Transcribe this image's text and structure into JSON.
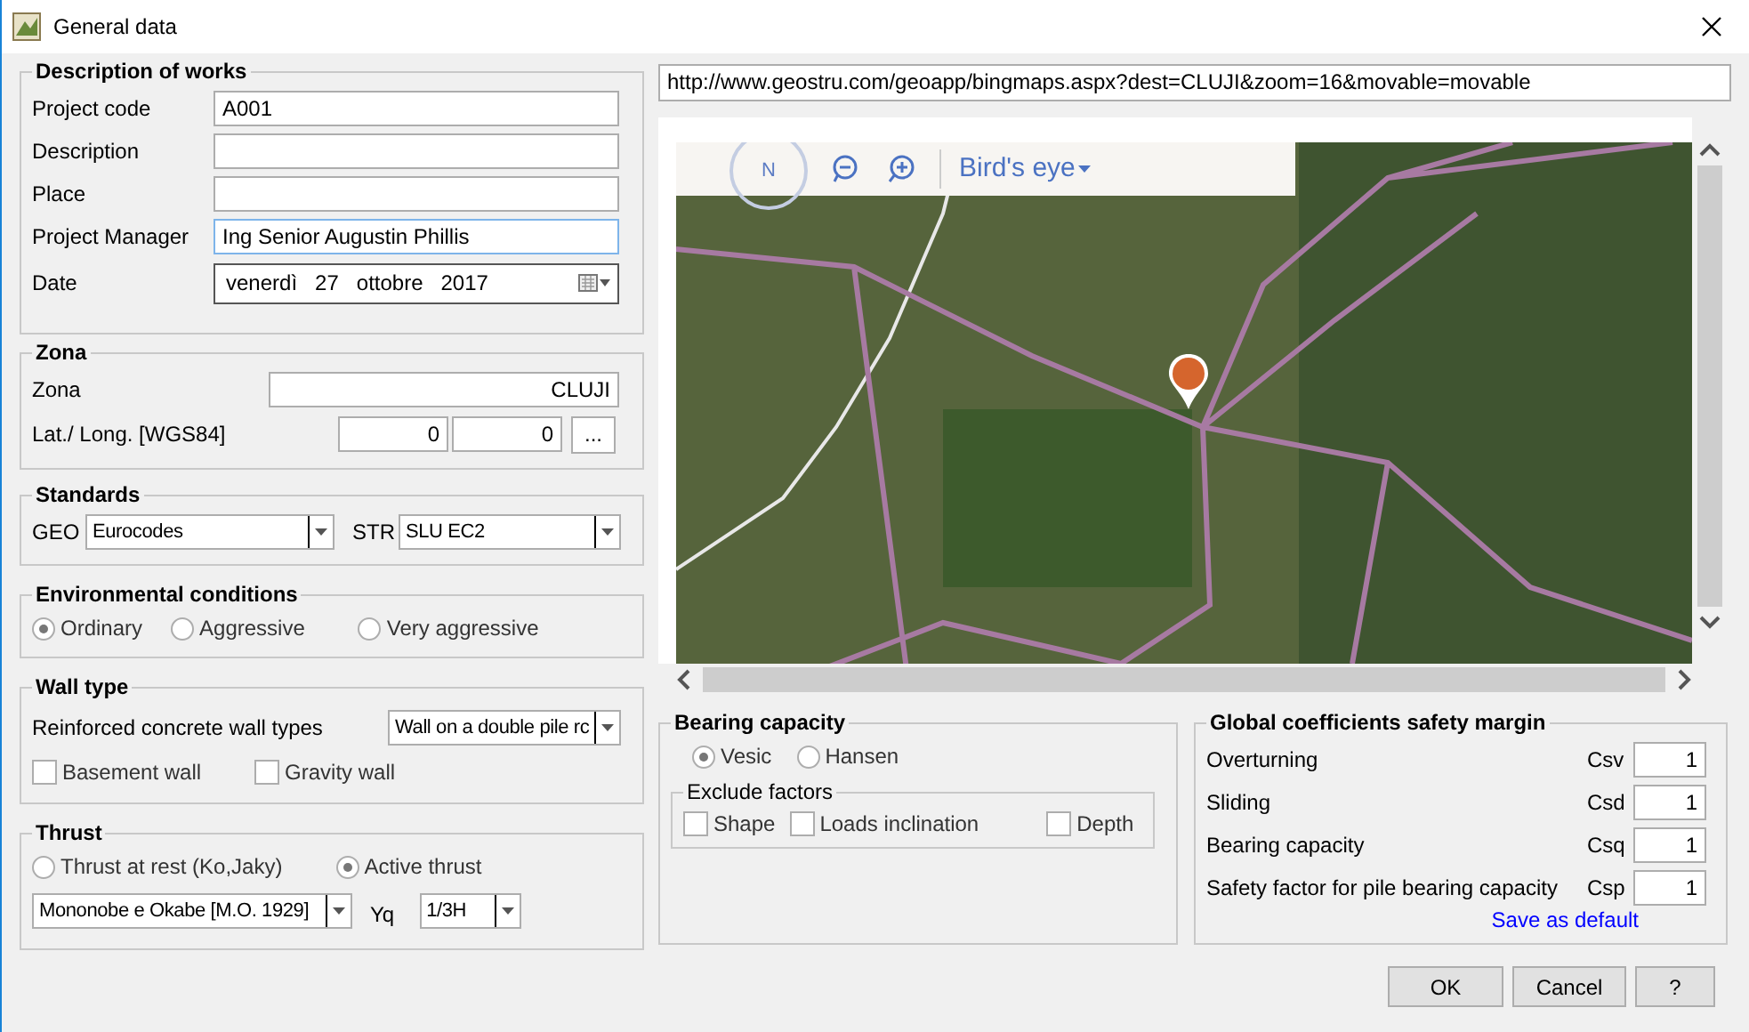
{
  "window": {
    "title": "General data"
  },
  "description_of_works": {
    "title": "Description of works",
    "fields": [
      {
        "label": "Project code",
        "value": "A001",
        "focused": false
      },
      {
        "label": "Description",
        "focused": false
      },
      {
        "label": "Place",
        "focused": false
      },
      {
        "label": "Project Manager",
        "value": "Ing Senior Augustin Phillis",
        "focused": true
      }
    ],
    "date": {
      "label": "Date",
      "weekday": "venerdì",
      "day": "27",
      "month": "ottobre",
      "year": "2017"
    }
  },
  "zona": {
    "title": "Zona",
    "zona_label": "Zona",
    "zona_value": "CLUJI",
    "coord_label": "Lat./ Long. [WGS84]",
    "latitude": "0",
    "longitude": "0",
    "browse_button": "..."
  },
  "standards": {
    "title": "Standards",
    "geo_label": "GEO",
    "geo_value": "Eurocodes",
    "str_label": "STR",
    "str_value": "SLU  EC2"
  },
  "environmental_conditions": {
    "title": "Environmental conditions",
    "options": [
      {
        "label": "Ordinary",
        "selected": true
      },
      {
        "label": "Aggressive",
        "selected": false
      },
      {
        "label": "Very aggressive",
        "selected": false
      }
    ]
  },
  "wall_type": {
    "title": "Wall type",
    "select_label": "Reinforced concrete wall types",
    "select_value": "Wall on a double pile rc",
    "checkboxes": [
      {
        "label": "Basement wall",
        "checked": false
      },
      {
        "label": "Gravity wall",
        "checked": false
      }
    ]
  },
  "thrust": {
    "title": "Thrust",
    "options": [
      {
        "label": "Thrust at rest (Ko,Jaky)",
        "selected": false
      },
      {
        "label": "Active thrust",
        "selected": true
      }
    ],
    "method_value": "Mononobe e Okabe [M.O. 1929]",
    "yq_label": "Yq",
    "yq_value": "1/3H"
  },
  "map": {
    "url": "http://www.geostru.com/geoapp/bingmaps.aspx?dest=CLUJI&zoom=16&movable=movable",
    "compass": "N",
    "view_mode": "Bird's eye"
  },
  "bearing_capacity": {
    "title": "Bearing capacity",
    "options": [
      {
        "label": "Vesic",
        "selected": true
      },
      {
        "label": "Hansen",
        "selected": false
      }
    ],
    "exclude_factors": {
      "title": "Exclude factors",
      "checkboxes": [
        {
          "label": "Shape",
          "checked": false
        },
        {
          "label": "Loads inclination",
          "checked": false
        },
        {
          "label": "Depth",
          "checked": false
        }
      ]
    }
  },
  "global_coefficients": {
    "title": "Global coefficients safety margin",
    "rows": [
      {
        "label": "Overturning",
        "code": "Csv",
        "value": "1"
      },
      {
        "label": "Sliding",
        "code": "Csd",
        "value": "1"
      },
      {
        "label": "Bearing capacity",
        "code": "Csq",
        "value": "1"
      },
      {
        "label": "Safety factor for pile bearing capacity",
        "code": "Csp",
        "value": "1"
      }
    ],
    "save_link": "Save as default"
  },
  "buttons": [
    "OK",
    "Cancel",
    "?"
  ]
}
